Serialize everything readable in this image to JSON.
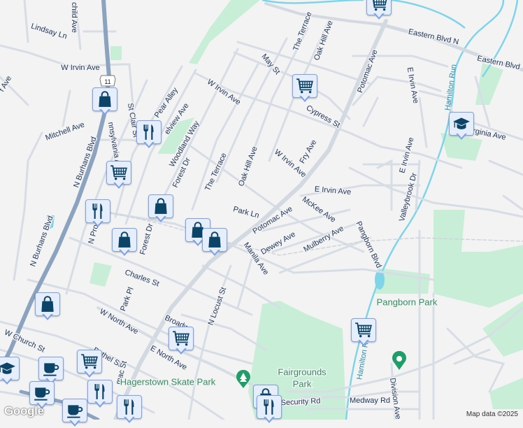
{
  "map": {
    "route_shield": "11",
    "street_labels": [
      "Lindsay Ln",
      "child Ave",
      "W Irvin Ave",
      "f Ave",
      "Mitchell Ave",
      "N Burhans Blvd",
      "nnsylvania A",
      "St Clair St",
      "Pear Alley",
      "elview Ave",
      "Woodland Way",
      "Forest Dr",
      "The Terrace",
      "Oak Hill Ave",
      "W Irvin Ave",
      "May St",
      "The Terrace",
      "Oak Hill Ave",
      "Eastern Blvd N",
      "Eastern Blvd",
      "Potomac Ave",
      "E Irvin Ave",
      "Cypress St",
      "E Virginia Ave",
      "Fry Ave",
      "W Irvin Ave",
      "E Irvin Ave",
      "E Irvin Ave",
      "Valleybrook Dr",
      "Park Ln",
      "Potomac Ave",
      "McKee Ave",
      "Mulberry Ave",
      "Dewey Ave",
      "Manila Ave",
      "Pangborn Blvd",
      "N Pro",
      "Forest Dr",
      "Charles St",
      "Park Pl",
      "W North Ave",
      "Broadw",
      "N Locust St",
      "E North Ave",
      "Bethel St",
      "W Church St",
      "mac St",
      "Security Rd",
      "Medway Rd",
      "Division Ave",
      "N Burhans Blvd"
    ],
    "water_labels": [
      "Hamilton Run",
      "Hamilton Run"
    ],
    "park_labels": [
      "Pangborn Park",
      "Fairgrounds",
      "Park",
      "Hagerstown Skate Park"
    ],
    "poi_markers": [
      {
        "category": "shopping",
        "icon": "shopping-bag-icon"
      },
      {
        "category": "shopping",
        "icon": "shopping-bag-icon"
      },
      {
        "category": "shopping",
        "icon": "shopping-bag-icon"
      },
      {
        "category": "shopping",
        "icon": "shopping-bag-icon"
      },
      {
        "category": "shopping",
        "icon": "shopping-bag-icon"
      },
      {
        "category": "shopping",
        "icon": "shopping-bag-icon"
      },
      {
        "category": "shopping",
        "icon": "shopping-bag-icon"
      },
      {
        "category": "restaurant",
        "icon": "fork-knife-icon"
      },
      {
        "category": "restaurant",
        "icon": "fork-knife-icon"
      },
      {
        "category": "restaurant",
        "icon": "fork-knife-icon"
      },
      {
        "category": "restaurant",
        "icon": "fork-knife-icon"
      },
      {
        "category": "restaurant",
        "icon": "fork-knife-icon"
      },
      {
        "category": "grocery",
        "icon": "shopping-cart-icon"
      },
      {
        "category": "grocery",
        "icon": "shopping-cart-icon"
      },
      {
        "category": "grocery",
        "icon": "shopping-cart-icon"
      },
      {
        "category": "grocery",
        "icon": "shopping-cart-icon"
      },
      {
        "category": "grocery",
        "icon": "shopping-cart-icon"
      },
      {
        "category": "grocery",
        "icon": "shopping-cart-icon"
      },
      {
        "category": "school",
        "icon": "graduation-cap-icon"
      },
      {
        "category": "school",
        "icon": "graduation-cap-icon"
      },
      {
        "category": "cafe",
        "icon": "coffee-cup-icon"
      },
      {
        "category": "cafe",
        "icon": "coffee-cup-icon"
      },
      {
        "category": "cafe",
        "icon": "coffee-cup-icon"
      }
    ],
    "credit": "Map data ©2025",
    "logo": "Google",
    "colors": {
      "background": "#f4f3f4",
      "park": "#c9eed8",
      "water": "#80d4e8",
      "highway": "#8ba3bf",
      "road": "#d6dde5",
      "icon": "#0b4467",
      "marker_fill": "#e6eefc",
      "marker_border": "#7fa2e3",
      "pin": "#1f9e6a"
    }
  }
}
